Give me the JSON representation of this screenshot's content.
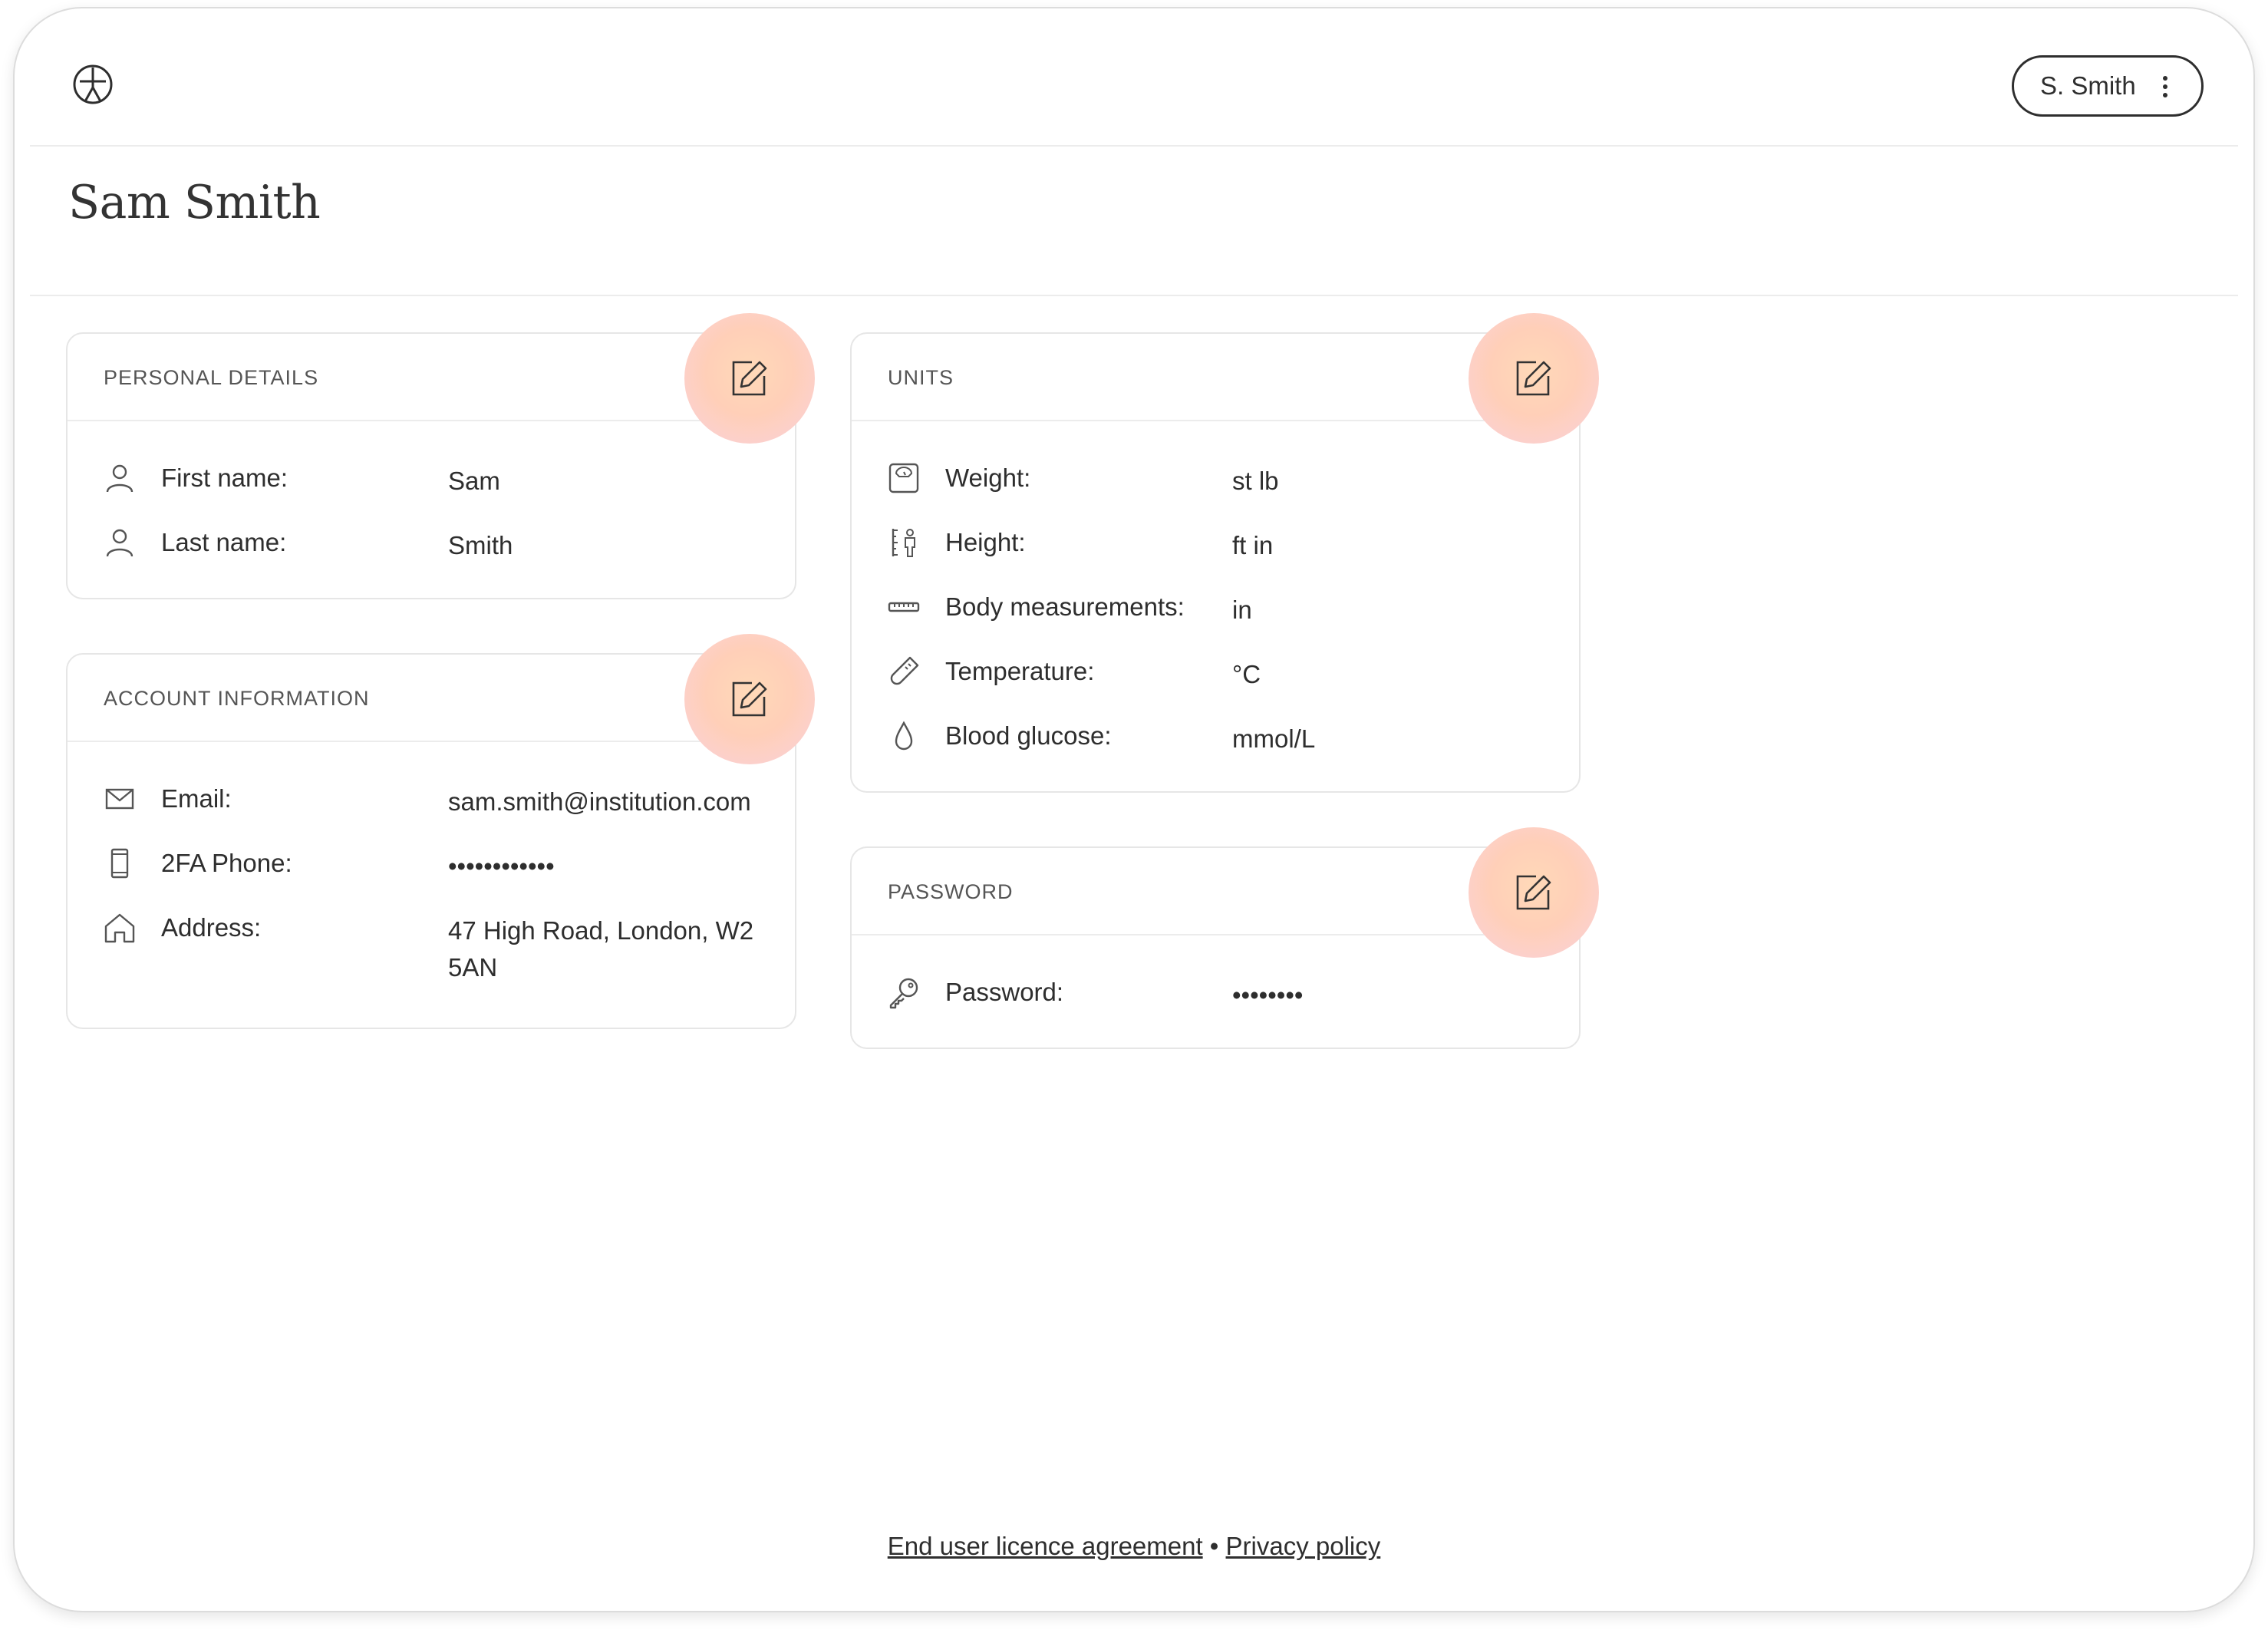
{
  "header": {
    "user_button_label": "S. Smith"
  },
  "page": {
    "title": "Sam Smith"
  },
  "personal_details": {
    "title": "PERSONAL DETAILS",
    "rows": [
      {
        "icon": "person-icon",
        "label": "First name:",
        "value": "Sam"
      },
      {
        "icon": "person-icon",
        "label": "Last name:",
        "value": "Smith"
      }
    ]
  },
  "account_information": {
    "title": "ACCOUNT INFORMATION",
    "rows": [
      {
        "icon": "envelope-icon",
        "label": "Email:",
        "value": "sam.smith@institution.com"
      },
      {
        "icon": "phone-icon",
        "label": "2FA Phone:",
        "value": "••••••••••••"
      },
      {
        "icon": "home-icon",
        "label": "Address:",
        "value_line1": "47 High Road, London, W2",
        "value_line2": "5AN"
      }
    ]
  },
  "units": {
    "title": "UNITS",
    "rows": [
      {
        "icon": "scale-icon",
        "label": "Weight:",
        "value": "st lb"
      },
      {
        "icon": "height-icon",
        "label": "Height:",
        "value": "ft in"
      },
      {
        "icon": "ruler-icon",
        "label": "Body measurements:",
        "value": "in"
      },
      {
        "icon": "thermometer-icon",
        "label": "Temperature:",
        "value": "°C"
      },
      {
        "icon": "drop-icon",
        "label": "Blood glucose:",
        "value": "mmol/L"
      }
    ]
  },
  "password": {
    "title": "PASSWORD",
    "rows": [
      {
        "icon": "key-icon",
        "label": "Password:",
        "value": "••••••••"
      }
    ]
  },
  "footer": {
    "eula": "End user licence agreement",
    "separator": " • ",
    "privacy": "Privacy policy"
  }
}
